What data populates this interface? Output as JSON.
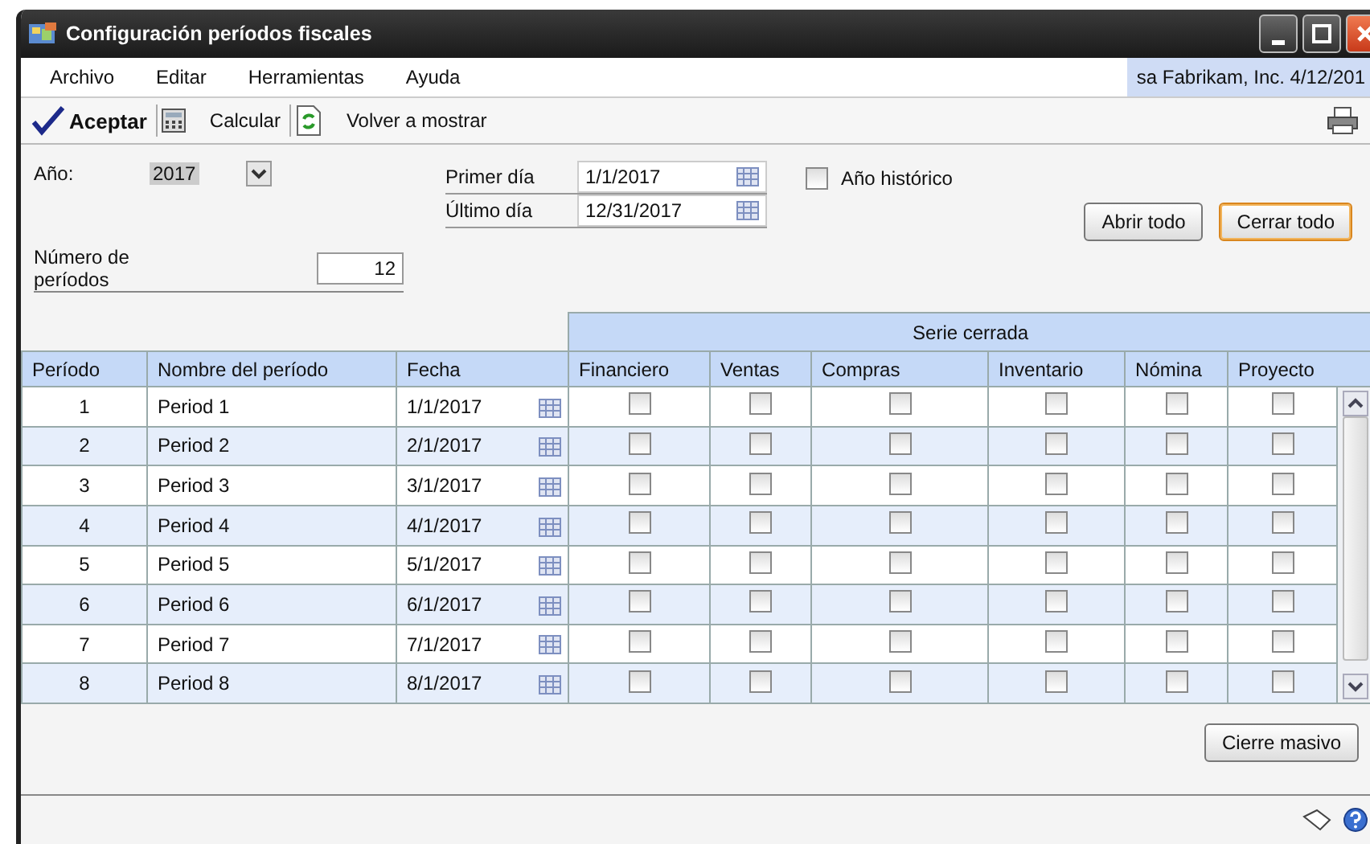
{
  "window": {
    "title": "Configuración períodos fiscales"
  },
  "menu": [
    "Archivo",
    "Editar",
    "Herramientas",
    "Ayuda"
  ],
  "user_info": "sa  Fabrikam, Inc.  4/12/201",
  "toolbar": [
    {
      "kind": "accept",
      "label": "Aceptar"
    },
    {
      "kind": "calculator",
      "label": "Calcular"
    },
    {
      "kind": "refresh",
      "label": "Volver a mostrar"
    }
  ],
  "form": {
    "year_label": "Año:",
    "year": "2017",
    "first_day_label": "Primer día",
    "first_day": "1/1/2017",
    "last_day_label": "Último día",
    "last_day": "12/31/2017",
    "periods_label": "Número de períodos",
    "periods": "12",
    "historic": {
      "label": "Año histórico",
      "checked": false
    },
    "buttons": [
      {
        "label": "Abrir todo",
        "focused": false
      },
      {
        "label": "Cerrar todo",
        "focused": true
      }
    ]
  },
  "table": {
    "group_header": "Serie cerrada",
    "columns": [
      "Período",
      "Nombre del período",
      "Fecha",
      "Financiero",
      "Ventas",
      "Compras",
      "Inventario",
      "Nómina",
      "Proyecto"
    ],
    "rows": [
      {
        "period": "1",
        "name": "Period 1",
        "date": "1/1/2017",
        "closed": [
          false,
          false,
          false,
          false,
          false,
          false
        ]
      },
      {
        "period": "2",
        "name": "Period 2",
        "date": "2/1/2017",
        "closed": [
          false,
          false,
          false,
          false,
          false,
          false
        ]
      },
      {
        "period": "3",
        "name": "Period 3",
        "date": "3/1/2017",
        "closed": [
          false,
          false,
          false,
          false,
          false,
          false
        ]
      },
      {
        "period": "4",
        "name": "Period 4",
        "date": "4/1/2017",
        "closed": [
          false,
          false,
          false,
          false,
          false,
          false
        ]
      },
      {
        "period": "5",
        "name": "Period 5",
        "date": "5/1/2017",
        "closed": [
          false,
          false,
          false,
          false,
          false,
          false
        ]
      },
      {
        "period": "6",
        "name": "Period 6",
        "date": "6/1/2017",
        "closed": [
          false,
          false,
          false,
          false,
          false,
          false
        ]
      },
      {
        "period": "7",
        "name": "Period 7",
        "date": "7/1/2017",
        "closed": [
          false,
          false,
          false,
          false,
          false,
          false
        ]
      },
      {
        "period": "8",
        "name": "Period 8",
        "date": "8/1/2017",
        "closed": [
          false,
          false,
          false,
          false,
          false,
          false
        ]
      }
    ]
  },
  "mass_close_button": "Cierre masivo"
}
